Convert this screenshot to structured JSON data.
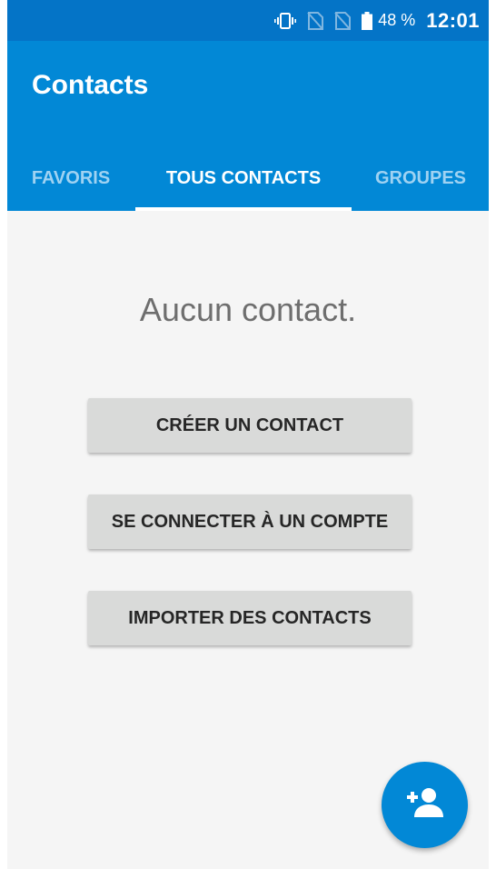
{
  "status_bar": {
    "icons": [
      "vibrate-icon",
      "no-sim-icon",
      "no-sim-icon",
      "battery-icon"
    ],
    "battery_percent": "48 %",
    "time": "12:01"
  },
  "app_bar": {
    "title": "Contacts"
  },
  "tabs": [
    {
      "label": "FAVORIS",
      "selected": false
    },
    {
      "label": "TOUS CONTACTS",
      "selected": true
    },
    {
      "label": "GROUPES",
      "selected": false
    }
  ],
  "empty_state": {
    "message": "Aucun contact.",
    "buttons": [
      {
        "label": "CRÉER UN CONTACT"
      },
      {
        "label": "SE CONNECTER À UN COMPTE"
      },
      {
        "label": "IMPORTER DES CONTACTS"
      }
    ]
  },
  "fab": {
    "icon": "add-person-icon"
  },
  "colors": {
    "status_bar": "#0474c7",
    "app_bar": "#0288d6",
    "inactive_tab": "#9fd2f2",
    "button": "#d9dad9",
    "background": "#f5f5f5"
  }
}
